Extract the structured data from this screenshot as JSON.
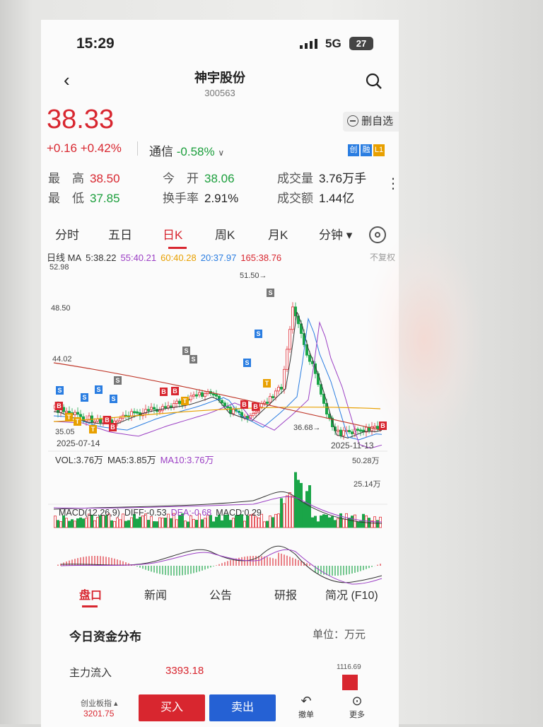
{
  "status_bar": {
    "time": "15:29",
    "network": "5G",
    "battery": "27"
  },
  "header": {
    "stock_name": "神宇股份",
    "stock_code": "300563"
  },
  "quote": {
    "price": "38.33",
    "change": "+0.16 +0.42%",
    "index_name": "通信",
    "index_change": "-0.58%",
    "watchlist_button": "删自选",
    "badges": [
      {
        "text": "创",
        "color": "#2a7de1"
      },
      {
        "text": "融",
        "color": "#2a7de1"
      },
      {
        "text": "L1",
        "color": "#e8a000"
      }
    ]
  },
  "stats": {
    "high_label": "最　高",
    "high_value": "38.50",
    "low_label": "最　低",
    "low_value": "37.85",
    "open_label": "今　开",
    "open_value": "38.06",
    "turnover_label": "换手率",
    "turnover_value": "2.91%",
    "volume_label": "成交量",
    "volume_value": "3.76万手",
    "amount_label": "成交额",
    "amount_value": "1.44亿"
  },
  "period_tabs": [
    "分时",
    "五日",
    "日K",
    "周K",
    "月K",
    "分钟 ▾"
  ],
  "active_period": "日K",
  "ma_legend": {
    "prefix": "日线 MA",
    "ma5": "5:38.22",
    "ma55": "55:40.21",
    "ma60": "60:40.28",
    "ma20": "20:37.97",
    "ma165": "165:38.76",
    "adjust": "不复权",
    "colors": {
      "ma5": "#333333",
      "ma55": "#9b3fc4",
      "ma60": "#e8a000",
      "ma20": "#2a7de1",
      "ma165": "#d8262f"
    }
  },
  "kline": {
    "y_labels": [
      "52.98",
      "48.50",
      "44.02",
      "35.05"
    ],
    "high_marker": "51.50→",
    "low_marker": "36.68→",
    "start_date": "2025-07-14",
    "end_date": "2025-11-13"
  },
  "volume": {
    "vol": "VOL:3.76万",
    "ma5": "MA5:3.85万",
    "ma10": "MA10:3.76万",
    "top_label": "50.28万",
    "mid_label": "25.14万"
  },
  "macd": {
    "title": "MACD(12,26,9)",
    "diff": "DIFF:-0.53",
    "dea": "DEA:-0.68",
    "macd": "MACD:0.29"
  },
  "bottom_tabs": [
    "盘口",
    "新闻",
    "公告",
    "研报",
    "简况 (F10)"
  ],
  "fund": {
    "title": "今日资金分布",
    "unit": "单位：万元",
    "inflow_label": "主力流入",
    "inflow_value": "3393.18",
    "bar_value": "1116.69"
  },
  "footer": {
    "index_label": "创业板指 ▴",
    "index_value": "3201.75",
    "buy": "买入",
    "sell": "卖出",
    "undo": "撤单",
    "more": "更多"
  }
}
